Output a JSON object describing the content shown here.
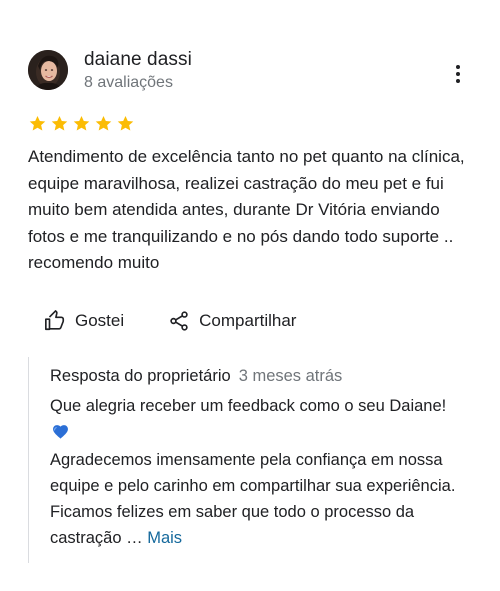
{
  "reviewer": {
    "name": "daiane dassi",
    "review_count": "8 avaliações",
    "avatar_icon": "profile-photo"
  },
  "rating": {
    "value": 5,
    "max": 5,
    "star_color": "#fbbc04"
  },
  "review": {
    "text": "Atendimento de excelência tanto no pet quanto na clínica, equipe maravilhosa, realizei castração do meu pet e fui muito bem atendida antes, durante Dr Vitória enviando fotos e me tranquilizando e no pós dando todo suporte .. recomendo muito"
  },
  "actions": {
    "like_label": "Gostei",
    "like_icon": "thumbs-up-icon",
    "share_label": "Compartilhar",
    "share_icon": "share-icon",
    "menu_icon": "more-vert-icon"
  },
  "owner_reply": {
    "label": "Resposta do proprietário",
    "time": "3 meses atrás",
    "text_line1": "Que alegria receber um feedback como o seu Daiane!",
    "heart_emoji": "💙",
    "text_line2": "Agradecemos imensamente pela confiança em nossa equipe e pelo carinho em compartilhar sua experiência. Ficamos felizes em saber que todo o processo da castração …",
    "more_label": "Mais",
    "more_color": "#1a73e8"
  }
}
